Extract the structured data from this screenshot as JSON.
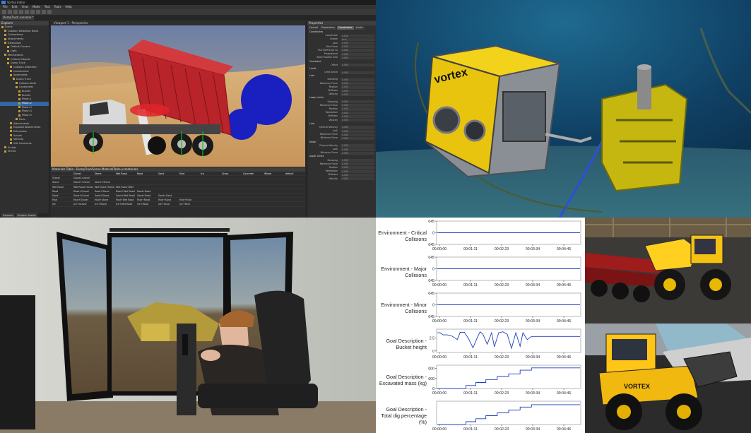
{
  "editor": {
    "title": "Vortex Editor",
    "menu": [
      "File",
      "Edit",
      "View",
      "Mode",
      "Tool",
      "Tools",
      "Help"
    ],
    "document_tab": "DumpTruck.vxscene *",
    "explorer": {
      "header": "Explorer",
      "items": [
        {
          "label": "Scene",
          "depth": 0
        },
        {
          "label": "Collision Detection Rules",
          "depth": 1
        },
        {
          "label": "Connections",
          "depth": 1
        },
        {
          "label": "Attachments",
          "depth": 1
        },
        {
          "label": "Extensions",
          "depth": 1
        },
        {
          "label": "Default Camera",
          "depth": 2
        },
        {
          "label": "Light",
          "depth": 2
        },
        {
          "label": "Mechanisms",
          "depth": 1
        },
        {
          "label": "Cultural Objects",
          "depth": 2
        },
        {
          "label": "Dump Truck",
          "depth": 2
        },
        {
          "label": "Collision Detection",
          "depth": 3
        },
        {
          "label": "Connections",
          "depth": 3
        },
        {
          "label": "Assemblies",
          "depth": 3
        },
        {
          "label": "Dump Truck",
          "depth": 4
        },
        {
          "label": "Collision Dete",
          "depth": 5
        },
        {
          "label": "Constraints",
          "depth": 5
        },
        {
          "label": "Bucket",
          "depth": 6
        },
        {
          "label": "Bucket",
          "depth": 6
        },
        {
          "label": "Piston 1",
          "depth": 6
        },
        {
          "label": "Piston 2",
          "depth": 6,
          "selected": true
        },
        {
          "label": "Piston 3",
          "depth": 6
        },
        {
          "label": "Piston 4",
          "depth": 6
        },
        {
          "label": "Piston 5",
          "depth": 6
        },
        {
          "label": "Parts",
          "depth": 5
        },
        {
          "label": "Attachments",
          "depth": 3
        },
        {
          "label": "Exposed Attachments",
          "depth": 3
        },
        {
          "label": "Extensions",
          "depth": 3
        },
        {
          "label": "Scripts",
          "depth": 3
        },
        {
          "label": "Vehicles",
          "depth": 3
        },
        {
          "label": "VHL Interfaces",
          "depth": 3
        },
        {
          "label": "Scripts",
          "depth": 1
        },
        {
          "label": "Terrain",
          "depth": 1
        }
      ],
      "bottom_tabs": [
        "Explorer",
        "Graphic Assets"
      ]
    },
    "viewport": {
      "header": "Viewport 1 - Perspective"
    },
    "materials_table": {
      "header": "Materials Table - DumpTruckScene.MaterialTable.vxmaterials",
      "columns": [
        "",
        "Gravel",
        "Stone",
        "Wet Road",
        "Road",
        "Sand",
        "Mud",
        "Ice",
        "Grass",
        "Concrete",
        "Wheel",
        "default"
      ],
      "rows": [
        [
          "Gravel",
          "Gravel-Gravel",
          "",
          "",
          "",
          "",
          "",
          "",
          "",
          "",
          "",
          ""
        ],
        [
          "Stone",
          "Stone+Gravel",
          "Stone+Stone",
          "",
          "",
          "",
          "",
          "",
          "",
          "",
          "",
          ""
        ],
        [
          "Wet Road",
          "Wet Road+Gravel",
          "Wet Road+Stone",
          "Wet Road+Wet",
          "",
          "",
          "",
          "",
          "",
          "",
          "",
          ""
        ],
        [
          "Road",
          "Road+Gravel",
          "Road+Stone",
          "Road+Wet Road",
          "Road+Road",
          "",
          "",
          "",
          "",
          "",
          "",
          ""
        ],
        [
          "Sand",
          "Sand+Gravel",
          "Sand+Stone",
          "Sand+Wet Road",
          "Sand+Road",
          "Sand+Sand",
          "",
          "",
          "",
          "",
          "",
          ""
        ],
        [
          "Mud",
          "Mud+Gravel",
          "Mud+Stone",
          "Mud+Wet Road",
          "Mud+Road",
          "Mud+Sand",
          "Mud+Mud",
          "",
          "",
          "",
          "",
          ""
        ],
        [
          "Ice",
          "Ice+Gravel",
          "Ice+Stone",
          "Ice+Wet Road",
          "Ice+Road",
          "Ice+Sand",
          "Ice+Mud",
          "",
          "",
          "",
          "",
          ""
        ]
      ]
    },
    "properties": {
      "header": "Properties",
      "tabs": [
        "Control",
        "Parameters",
        "Coordinates",
        "Limits"
      ],
      "active_tab": "Coordinates",
      "rows": [
        {
          "k": "Coordinates",
          "section": true
        },
        {
          "k": "Coordinate",
          "v": "0.000"
        },
        {
          "k": "Enable",
          "v": "true"
        },
        {
          "k": "Lock",
          "v": "0.000"
        },
        {
          "k": "Max Force",
          "v": "0.000"
        },
        {
          "k": "Hull Reference Lo",
          "v": "0.000"
        },
        {
          "k": "Proportional",
          "v": "0.000"
        },
        {
          "k": "State Position Este",
          "v": "0.000"
        },
        {
          "k": "Constraint",
          "section": true
        },
        {
          "k": "Offset",
          "v": "0.000"
        },
        {
          "k": "Limits",
          "section": true
        },
        {
          "k": "Limit Active",
          "v": "0.000"
        },
        {
          "k": "Lock",
          "section": true
        },
        {
          "k": "Damping",
          "v": "0.000"
        },
        {
          "k": "Maximum Force",
          "v": "0.000"
        },
        {
          "k": "Position",
          "v": "0.000"
        },
        {
          "k": "Stiffness",
          "v": "0.000"
        },
        {
          "k": "Velocity",
          "v": "0.000"
        },
        {
          "k": "Lower Limits",
          "section": true
        },
        {
          "k": "Damping",
          "v": "0.000"
        },
        {
          "k": "Maximum Force",
          "v": "0.000"
        },
        {
          "k": "Position",
          "v": "0.000"
        },
        {
          "k": "Restitution",
          "v": "0.000"
        },
        {
          "k": "Stiffness",
          "v": "0.000"
        },
        {
          "k": "Velocity",
          "v": "0.000"
        },
        {
          "k": "Lock",
          "section": true
        },
        {
          "k": "Desired Velocity",
          "v": "0.000"
        },
        {
          "k": "Lock",
          "v": "0.000"
        },
        {
          "k": "Maximum Force",
          "v": "0.000"
        },
        {
          "k": "Minimum Force",
          "v": "0.000"
        },
        {
          "k": "Motor",
          "section": true
        },
        {
          "k": "Desired Velocity",
          "v": "0.000"
        },
        {
          "k": "Lock",
          "v": "0.000"
        },
        {
          "k": "Minimum Force",
          "v": "0.000"
        },
        {
          "k": "Upper Limits",
          "section": true
        },
        {
          "k": "Damping",
          "v": "0.000"
        },
        {
          "k": "Maximum Force",
          "v": "0.000"
        },
        {
          "k": "Position",
          "v": "0.000"
        },
        {
          "k": "Restitution",
          "v": "0.000"
        },
        {
          "k": "Stiffness",
          "v": "0.000"
        },
        {
          "k": "Velocity",
          "v": "0.000"
        }
      ],
      "bottom_tabs": [
        "Properties",
        "Command"
      ]
    }
  },
  "rov": {
    "brand": "vortex"
  },
  "loader": {
    "brand": "VORTEX"
  },
  "charts": {
    "x_ticks": [
      "00:00:00",
      "00:01:11",
      "00:02:23",
      "00:03:34",
      "00:04:46"
    ],
    "line_color": "#1f3fbf"
  },
  "chart_data": [
    {
      "type": "line",
      "title": "Environment - Critical Collisions",
      "x": [
        "00:00:00",
        "00:04:46"
      ],
      "y_ticks": [
        0.045,
        0,
        -0.045
      ],
      "ylim": [
        -0.045,
        0.045
      ],
      "series": [
        {
          "values": [
            0,
            0
          ]
        }
      ]
    },
    {
      "type": "line",
      "title": "Environment - Major Collisions",
      "x": [
        "00:00:00",
        "00:04:46"
      ],
      "y_ticks": [
        0.045,
        0,
        -0.045
      ],
      "ylim": [
        -0.045,
        0.045
      ],
      "series": [
        {
          "values": [
            0,
            0
          ]
        }
      ]
    },
    {
      "type": "line",
      "title": "Environment - Minor Collisions",
      "x": [
        "00:00:00",
        "00:04:46"
      ],
      "y_ticks": [
        0.045,
        0,
        -0.045
      ],
      "ylim": [
        -0.045,
        0.045
      ],
      "series": [
        {
          "values": [
            0,
            0
          ]
        }
      ]
    },
    {
      "type": "line",
      "title": "Goal Description - Bucket height",
      "y_ticks": [
        2.5,
        0
      ],
      "ylim": [
        -0.3,
        4.2
      ],
      "x": [
        0,
        0.02,
        0.04,
        0.07,
        0.1,
        0.14,
        0.16,
        0.19,
        0.22,
        0.25,
        0.28,
        0.3,
        0.32,
        0.35,
        0.38,
        0.4,
        0.43,
        0.46,
        0.49,
        0.52,
        0.55,
        0.58,
        0.6,
        0.63,
        0.66,
        1
      ],
      "series": [
        {
          "values": [
            3.5,
            3.5,
            3.1,
            3.1,
            2.9,
            2.2,
            3.6,
            3.6,
            2.3,
            0.6,
            2.6,
            3.7,
            3.2,
            1.3,
            3.5,
            0.8,
            3.5,
            3.7,
            3.2,
            0.5,
            3.5,
            0.9,
            3.5,
            2.2,
            2.8,
            2.8
          ]
        }
      ]
    },
    {
      "type": "line",
      "title": "Goal Description - Excavated mass (kg)",
      "y_ticks": [
        12000,
        6000,
        0
      ],
      "ylim": [
        0,
        14000
      ],
      "x": [
        0,
        0.2,
        0.2,
        0.27,
        0.27,
        0.34,
        0.34,
        0.42,
        0.42,
        0.5,
        0.5,
        0.58,
        0.58,
        0.66,
        0.66,
        1
      ],
      "series": [
        {
          "values": [
            0,
            0,
            1800,
            1800,
            3600,
            3600,
            5400,
            5400,
            7200,
            7200,
            8800,
            8800,
            11000,
            11000,
            12400,
            12400
          ]
        }
      ]
    },
    {
      "type": "line",
      "title": "Goal Description - Total dig percentage (%)",
      "y_ticks": [],
      "ylim": [
        0,
        100
      ],
      "x": [
        0,
        0.2,
        0.2,
        0.27,
        0.27,
        0.34,
        0.34,
        0.42,
        0.42,
        0.5,
        0.5,
        0.58,
        0.58,
        0.66,
        0.66,
        1
      ],
      "series": [
        {
          "values": [
            0,
            0,
            12,
            12,
            25,
            25,
            38,
            38,
            50,
            50,
            62,
            62,
            75,
            75,
            85,
            85
          ]
        }
      ]
    }
  ]
}
